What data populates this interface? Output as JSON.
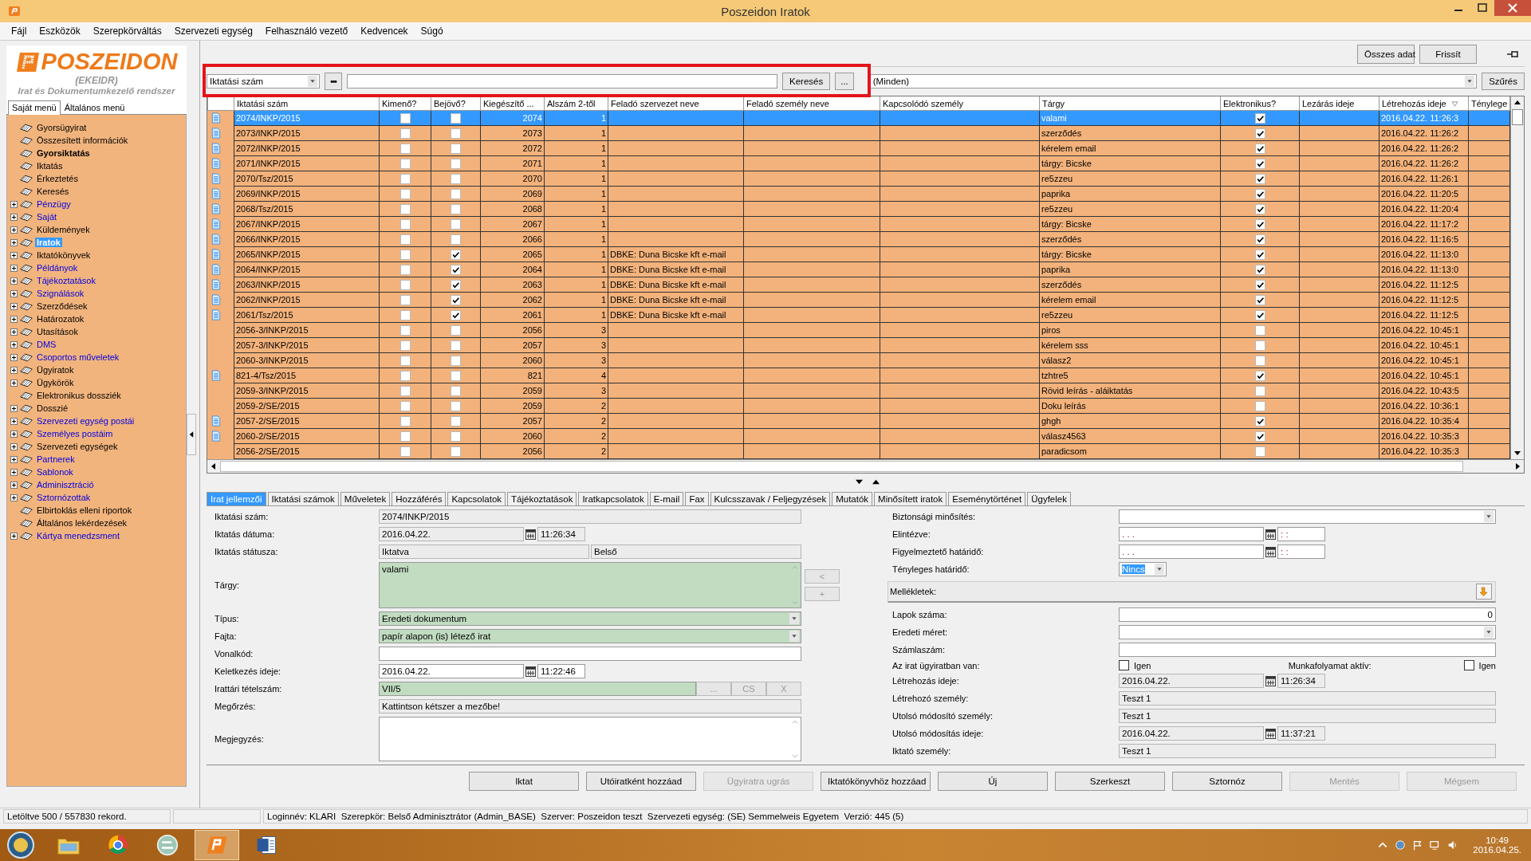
{
  "window": {
    "title": "Poszeidon Iratok"
  },
  "menu": [
    "Fájl",
    "Eszközök",
    "Szerepkörváltás",
    "Szervezeti egység",
    "Felhasználó vezető",
    "Kedvencek",
    "Súgó"
  ],
  "logo": {
    "name": "POSZEIDON",
    "subtitle": "(EKEIDR)",
    "tagline": "Irat és Dokumentumkezelő rendszer"
  },
  "sidebar": {
    "tabs": [
      {
        "label": "Saját menü",
        "selected": true
      },
      {
        "label": "Általános menü",
        "selected": false
      }
    ],
    "items": [
      {
        "label": "Gyorsügyirat",
        "expandable": false,
        "link": false,
        "bold": false,
        "selected": false
      },
      {
        "label": "Összesített információk",
        "expandable": false,
        "link": false,
        "bold": false,
        "selected": false
      },
      {
        "label": "Gyorsiktatás",
        "expandable": false,
        "link": false,
        "bold": true,
        "selected": false
      },
      {
        "label": "Iktatás",
        "expandable": false,
        "link": false,
        "bold": false,
        "selected": false
      },
      {
        "label": "Érkeztetés",
        "expandable": false,
        "link": false,
        "bold": false,
        "selected": false
      },
      {
        "label": "Keresés",
        "expandable": false,
        "link": false,
        "bold": false,
        "selected": false
      },
      {
        "label": "Pénzügy",
        "expandable": true,
        "link": true,
        "bold": false,
        "selected": false
      },
      {
        "label": "Saját",
        "expandable": true,
        "link": true,
        "bold": false,
        "selected": false
      },
      {
        "label": "Küldemények",
        "expandable": true,
        "link": false,
        "bold": false,
        "selected": false
      },
      {
        "label": "Iratok",
        "expandable": true,
        "link": false,
        "bold": true,
        "selected": true
      },
      {
        "label": "Iktatókönyvek",
        "expandable": true,
        "link": false,
        "bold": false,
        "selected": false
      },
      {
        "label": "Példányok",
        "expandable": true,
        "link": true,
        "bold": false,
        "selected": false
      },
      {
        "label": "Tájékoztatások",
        "expandable": true,
        "link": true,
        "bold": false,
        "selected": false
      },
      {
        "label": "Szignálások",
        "expandable": true,
        "link": true,
        "bold": false,
        "selected": false
      },
      {
        "label": "Szerződések",
        "expandable": true,
        "link": false,
        "bold": false,
        "selected": false
      },
      {
        "label": "Határozatok",
        "expandable": true,
        "link": false,
        "bold": false,
        "selected": false
      },
      {
        "label": "Utasítások",
        "expandable": true,
        "link": false,
        "bold": false,
        "selected": false
      },
      {
        "label": "DMS",
        "expandable": true,
        "link": true,
        "bold": false,
        "selected": false
      },
      {
        "label": "Csoportos műveletek",
        "expandable": true,
        "link": true,
        "bold": false,
        "selected": false
      },
      {
        "label": "Ügyiratok",
        "expandable": true,
        "link": false,
        "bold": false,
        "selected": false
      },
      {
        "label": "Ügykörök",
        "expandable": true,
        "link": false,
        "bold": false,
        "selected": false
      },
      {
        "label": "Elektronikus dossziék",
        "expandable": false,
        "link": false,
        "bold": false,
        "selected": false
      },
      {
        "label": "Dosszié",
        "expandable": true,
        "link": false,
        "bold": false,
        "selected": false
      },
      {
        "label": "Szervezeti egység postái",
        "expandable": true,
        "link": true,
        "bold": false,
        "selected": false
      },
      {
        "label": "Személyes postáim",
        "expandable": true,
        "link": true,
        "bold": false,
        "selected": false
      },
      {
        "label": "Szervezeti egységek",
        "expandable": true,
        "link": false,
        "bold": false,
        "selected": false
      },
      {
        "label": "Partnerek",
        "expandable": true,
        "link": true,
        "bold": false,
        "selected": false
      },
      {
        "label": "Sablonok",
        "expandable": true,
        "link": true,
        "bold": false,
        "selected": false
      },
      {
        "label": "Adminisztráció",
        "expandable": true,
        "link": true,
        "bold": false,
        "selected": false
      },
      {
        "label": "Sztornózottak",
        "expandable": true,
        "link": true,
        "bold": false,
        "selected": false
      },
      {
        "label": "Elbirtoklás elleni riportok",
        "expandable": false,
        "link": false,
        "bold": false,
        "selected": false
      },
      {
        "label": "Általános lekérdezések",
        "expandable": false,
        "link": false,
        "bold": false,
        "selected": false
      },
      {
        "label": "Kártya menedzsment",
        "expandable": true,
        "link": true,
        "bold": false,
        "selected": false
      }
    ]
  },
  "toolbar": {
    "buttons": [
      "Összes adat",
      "Frissít"
    ]
  },
  "search": {
    "field_combo": "Iktatási szám",
    "more_button": "•••",
    "search_button": "Keresés",
    "options_button": "...",
    "filter_combo": "(Minden)",
    "filter_button": "Szűrés"
  },
  "table": {
    "columns": [
      "Iktatási szám",
      "Kimenő?",
      "Bejövő?",
      "Kiegészítő ...",
      "Alszám 2-től",
      "Feladó szervezet neve",
      "Feladó személy neve",
      "Kapcsolódó személy",
      "Tárgy",
      "Elektronikus?",
      "Lezárás ideje",
      "Létrehozás ideje",
      "Ténylege"
    ],
    "rows": [
      {
        "number": "2074/INKP/2015",
        "document": true,
        "outgoing": false,
        "incoming": false,
        "supplement": "2074",
        "subnumber": "1",
        "subject": "valami",
        "electronic": true,
        "created": "2016.04.22. 11:26:3",
        "selected": true
      },
      {
        "number": "2073/INKP/2015",
        "document": true,
        "outgoing": false,
        "incoming": false,
        "supplement": "2073",
        "subnumber": "1",
        "subject": "szerződés",
        "electronic": true,
        "created": "2016.04.22. 11:26:2",
        "selected": false
      },
      {
        "number": "2072/INKP/2015",
        "document": true,
        "outgoing": false,
        "incoming": false,
        "supplement": "2072",
        "subnumber": "1",
        "subject": "kérelem email",
        "electronic": true,
        "created": "2016.04.22. 11:26:2",
        "selected": false
      },
      {
        "number": "2071/INKP/2015",
        "document": true,
        "outgoing": false,
        "incoming": false,
        "supplement": "2071",
        "subnumber": "1",
        "subject": "tárgy: Bicske",
        "electronic": true,
        "created": "2016.04.22. 11:26:2",
        "selected": false
      },
      {
        "number": "2070/Tsz/2015",
        "document": true,
        "outgoing": false,
        "incoming": false,
        "supplement": "2070",
        "subnumber": "1",
        "subject": "re5zzeu",
        "electronic": true,
        "created": "2016.04.22. 11:26:1",
        "selected": false
      },
      {
        "number": "2069/INKP/2015",
        "document": true,
        "outgoing": false,
        "incoming": false,
        "supplement": "2069",
        "subnumber": "1",
        "subject": "paprika",
        "electronic": true,
        "created": "2016.04.22. 11:20:5",
        "selected": false
      },
      {
        "number": "2068/Tsz/2015",
        "document": true,
        "outgoing": false,
        "incoming": false,
        "supplement": "2068",
        "subnumber": "1",
        "subject": "re5zzeu",
        "electronic": true,
        "created": "2016.04.22. 11:20:4",
        "selected": false
      },
      {
        "number": "2067/INKP/2015",
        "document": true,
        "outgoing": false,
        "incoming": false,
        "supplement": "2067",
        "subnumber": "1",
        "subject": "tárgy: Bicske",
        "electronic": true,
        "created": "2016.04.22. 11:17:2",
        "selected": false
      },
      {
        "number": "2066/INKP/2015",
        "document": true,
        "outgoing": false,
        "incoming": false,
        "supplement": "2066",
        "subnumber": "1",
        "subject": "szerződés",
        "electronic": true,
        "created": "2016.04.22. 11:16:5",
        "selected": false
      },
      {
        "number": "2065/INKP/2015",
        "document": true,
        "outgoing": false,
        "incoming": true,
        "supplement": "2065",
        "subnumber": "1",
        "sender_org": "DBKE: Duna Bicske kft e-mail",
        "subject": "tárgy: Bicske",
        "electronic": true,
        "created": "2016.04.22. 11:13:0",
        "selected": false
      },
      {
        "number": "2064/INKP/2015",
        "document": true,
        "outgoing": false,
        "incoming": true,
        "supplement": "2064",
        "subnumber": "1",
        "sender_org": "DBKE: Duna Bicske kft e-mail",
        "subject": "paprika",
        "electronic": true,
        "created": "2016.04.22. 11:13:0",
        "selected": false
      },
      {
        "number": "2063/INKP/2015",
        "document": true,
        "outgoing": false,
        "incoming": true,
        "supplement": "2063",
        "subnumber": "1",
        "sender_org": "DBKE: Duna Bicske kft e-mail",
        "subject": "szerződés",
        "electronic": true,
        "created": "2016.04.22. 11:12:5",
        "selected": false
      },
      {
        "number": "2062/INKP/2015",
        "document": true,
        "outgoing": false,
        "incoming": true,
        "supplement": "2062",
        "subnumber": "1",
        "sender_org": "DBKE: Duna Bicske kft e-mail",
        "subject": "kérelem email",
        "electronic": true,
        "created": "2016.04.22. 11:12:5",
        "selected": false
      },
      {
        "number": "2061/Tsz/2015",
        "document": true,
        "outgoing": false,
        "incoming": true,
        "supplement": "2061",
        "subnumber": "1",
        "sender_org": "DBKE: Duna Bicske kft e-mail",
        "subject": "re5zzeu",
        "electronic": true,
        "created": "2016.04.22. 11:12:5",
        "selected": false
      },
      {
        "number": "2056-3/INKP/2015",
        "document": false,
        "outgoing": false,
        "incoming": false,
        "supplement": "2056",
        "subnumber": "3",
        "subject": "piros",
        "electronic": false,
        "created": "2016.04.22. 10:45:1",
        "selected": false
      },
      {
        "number": "2057-3/INKP/2015",
        "document": false,
        "outgoing": false,
        "incoming": false,
        "supplement": "2057",
        "subnumber": "3",
        "subject": "kérelem sss",
        "electronic": false,
        "created": "2016.04.22. 10:45:1",
        "selected": false
      },
      {
        "number": "2060-3/INKP/2015",
        "document": false,
        "outgoing": false,
        "incoming": false,
        "supplement": "2060",
        "subnumber": "3",
        "subject": "válasz2",
        "electronic": false,
        "created": "2016.04.22. 10:45:1",
        "selected": false
      },
      {
        "number": "821-4/Tsz/2015",
        "document": true,
        "outgoing": false,
        "incoming": false,
        "supplement": "821",
        "subnumber": "4",
        "subject": "tzhtre5",
        "electronic": true,
        "created": "2016.04.22. 10:45:1",
        "selected": false
      },
      {
        "number": "2059-3/INKP/2015",
        "document": false,
        "outgoing": false,
        "incoming": false,
        "supplement": "2059",
        "subnumber": "3",
        "subject": "Rövid leírás - aláiktatás",
        "electronic": false,
        "created": "2016.04.22. 10:43:5",
        "selected": false
      },
      {
        "number": "2059-2/SE/2015",
        "document": false,
        "outgoing": false,
        "incoming": false,
        "supplement": "2059",
        "subnumber": "2",
        "subject": "Doku leírás",
        "electronic": false,
        "created": "2016.04.22. 10:36:1",
        "selected": false
      },
      {
        "number": "2057-2/SE/2015",
        "document": true,
        "outgoing": false,
        "incoming": false,
        "supplement": "2057",
        "subnumber": "2",
        "subject": "ghgh",
        "electronic": true,
        "created": "2016.04.22. 10:35:4",
        "selected": false
      },
      {
        "number": "2060-2/SE/2015",
        "document": true,
        "outgoing": false,
        "incoming": false,
        "supplement": "2060",
        "subnumber": "2",
        "subject": "válasz4563",
        "electronic": true,
        "created": "2016.04.22. 10:35:3",
        "selected": false
      },
      {
        "number": "2056-2/SE/2015",
        "document": false,
        "outgoing": false,
        "incoming": false,
        "supplement": "2056",
        "subnumber": "2",
        "subject": "paradicsom",
        "electronic": false,
        "created": "2016.04.22. 10:35:3",
        "selected": false
      }
    ]
  },
  "detail_tabs": [
    {
      "label": "Irat jellemzői",
      "selected": true
    },
    {
      "label": "Iktatási számok",
      "selected": false
    },
    {
      "label": "Műveletek",
      "selected": false
    },
    {
      "label": "Hozzáférés",
      "selected": false
    },
    {
      "label": "Kapcsolatok",
      "selected": false
    },
    {
      "label": "Tájékoztatások",
      "selected": false
    },
    {
      "label": "Iratkapcsolatok",
      "selected": false
    },
    {
      "label": "E-mail",
      "selected": false
    },
    {
      "label": "Fax",
      "selected": false
    },
    {
      "label": "Kulcsszavak / Feljegyzések",
      "selected": false
    },
    {
      "label": "Mutatók",
      "selected": false
    },
    {
      "label": "Minősített iratok",
      "selected": false
    },
    {
      "label": "Eseménytörténet",
      "selected": false
    },
    {
      "label": "Ügyfelek",
      "selected": false
    }
  ],
  "form": {
    "left": [
      {
        "kind": "text",
        "label": "Iktatási szám:",
        "value": "2074/INKP/2015",
        "readonly": true,
        "required": false
      },
      {
        "kind": "date",
        "label": "Iktatás dátuma:",
        "date": "2016.04.22.",
        "time": "11:26:34",
        "readonly": true,
        "required": false
      },
      {
        "kind": "pair",
        "label": "Iktatás státusza:",
        "values": [
          "Iktatva",
          "Belső"
        ],
        "readonly": true,
        "required": false
      },
      {
        "kind": "textarea",
        "label": "Tárgy:",
        "value": "valami",
        "readonly": false,
        "required": true,
        "side_buttons": [
          {
            "label": "<",
            "disabled": true
          },
          {
            "label": "+",
            "disabled": true
          }
        ]
      },
      {
        "kind": "select",
        "label": "Típus:",
        "value": "Eredeti dokumentum",
        "readonly": false,
        "required": true
      },
      {
        "kind": "select",
        "label": "Fajta:",
        "value": "papír alapon (is) létező irat",
        "readonly": false,
        "required": true
      },
      {
        "kind": "text",
        "label": "Vonalkód:",
        "readonly": false,
        "required": false
      },
      {
        "kind": "date",
        "label": "Keletkezés ideje:",
        "date": "2016.04.22.",
        "time": "11:22:46",
        "readonly": false,
        "required": false
      },
      {
        "kind": "archive",
        "label": "Irattári tételszám:",
        "value": "VII/5",
        "readonly": false,
        "required": true,
        "buttons": [
          {
            "label": "...",
            "disabled": true
          },
          {
            "label": "CS",
            "disabled": true
          },
          {
            "label": "X",
            "disabled": true
          }
        ]
      },
      {
        "kind": "text",
        "label": "Megőrzés:",
        "value": "Kattintson kétszer a mezőbe!",
        "readonly": true,
        "required": false
      },
      {
        "kind": "textarea",
        "label": "Megjegyzés:",
        "readonly": false,
        "required": false
      }
    ],
    "right": [
      {
        "kind": "select",
        "label": "Biztonsági minősítés:",
        "readonly": false,
        "required": false
      },
      {
        "kind": "date",
        "label": "Elintézve:",
        "date_placeholder": ". . .",
        "time_placeholder": ": :",
        "readonly": false,
        "required": false
      },
      {
        "kind": "date",
        "label": "Figyelmeztető határidő:",
        "date_placeholder": ". . .",
        "time_placeholder": ": :",
        "readonly": false,
        "required": false
      },
      {
        "kind": "small_select",
        "label": "Tényleges határidő:",
        "value": "Nincs",
        "readonly": false,
        "required": false
      },
      {
        "kind": "panel",
        "label": "Mellékletek:"
      },
      {
        "kind": "number",
        "label": "Lapok száma:",
        "value": "0",
        "readonly": false,
        "required": false
      },
      {
        "kind": "select",
        "label": "Eredeti méret:",
        "readonly": false,
        "required": false
      },
      {
        "kind": "text",
        "label": "Számlaszám:",
        "readonly": false,
        "required": false
      },
      {
        "kind": "checks",
        "items": [
          {
            "label": "Az irat ügyiratban van:",
            "option": "Igen",
            "checked": false
          },
          {
            "label": "Munkafolyamat aktív:",
            "option": "Igen",
            "checked": false
          }
        ]
      },
      {
        "kind": "date",
        "label": "Létrehozás ideje:",
        "date": "2016.04.22.",
        "time": "11:26:34",
        "readonly": true,
        "required": false
      },
      {
        "kind": "text",
        "label": "Létrehozó személy:",
        "value": "Teszt 1",
        "readonly": true,
        "required": false
      },
      {
        "kind": "text",
        "label": "Utolsó módosító személy:",
        "value": "Teszt 1",
        "readonly": true,
        "required": false
      },
      {
        "kind": "date",
        "label": "Utolsó módosítás ideje:",
        "date": "2016.04.22.",
        "time": "11:37:21",
        "readonly": true,
        "required": false
      },
      {
        "kind": "text",
        "label": "Iktató személy:",
        "value": "Teszt 1",
        "readonly": true,
        "required": false
      }
    ]
  },
  "actions": [
    {
      "label": "Iktat",
      "disabled": false
    },
    {
      "label": "Utóiratként hozzáad",
      "disabled": false
    },
    {
      "label": "Ügyiratra ugrás",
      "disabled": true
    },
    {
      "label": "Iktatókönyvhöz hozzáad",
      "disabled": false
    },
    {
      "label": "Új",
      "disabled": false
    },
    {
      "label": "Szerkeszt",
      "disabled": false
    },
    {
      "label": "Sztornóz",
      "disabled": false
    },
    {
      "label": "Mentés",
      "disabled": true
    },
    {
      "label": "Mégsem",
      "disabled": true
    }
  ],
  "status_bar": {
    "records": "Letöltve 500 / 557830 rekord.",
    "session": "Loginnév: KLARI  Szerepkör: Belső Adminisztrátor (Admin_BASE)  Szerver: Poszeidon teszt  Szervezeti egység: (SE) Semmelweis Egyetem  Verzió: 445 (5)"
  },
  "taskbar": {
    "apps": [
      {
        "kind": "folder",
        "active": false
      },
      {
        "kind": "browser",
        "active": false
      },
      {
        "kind": "globe",
        "active": false
      },
      {
        "kind": "poszeidon",
        "active": true
      },
      {
        "kind": "word",
        "active": false
      }
    ],
    "time": "10:49",
    "date": "2016.04.25."
  }
}
